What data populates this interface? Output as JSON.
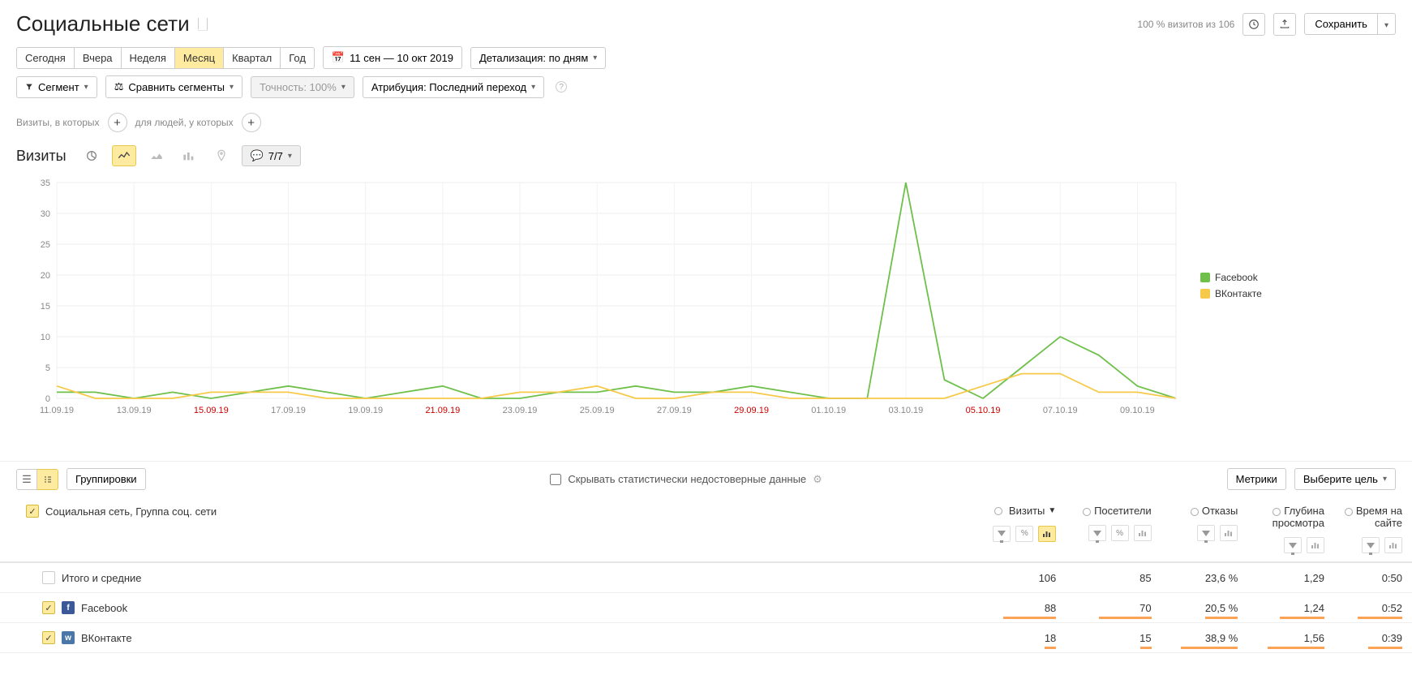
{
  "title": "Социальные сети",
  "visits_info": "100 % визитов из 106",
  "save_label": "Сохранить",
  "periods": {
    "today": "Сегодня",
    "yesterday": "Вчера",
    "week": "Неделя",
    "month": "Месяц",
    "quarter": "Квартал",
    "year": "Год"
  },
  "date_range": "11 сен — 10 окт 2019",
  "detail_label": "Детализация: по дням",
  "segment_label": "Сегмент",
  "compare_label": "Сравнить сегменты",
  "accuracy_label": "Точность: 100%",
  "attribution_label": "Атрибуция: Последний переход",
  "filters": {
    "visits": "Визиты, в которых",
    "people": "для людей, у которых"
  },
  "metric_title": "Визиты",
  "series_count": "7/7",
  "legend": {
    "facebook": "Facebook",
    "vkontakte": "ВКонтакте"
  },
  "colors": {
    "facebook": "#6ec04a",
    "vkontakte": "#f7c948"
  },
  "groupings_label": "Группировки",
  "hide_unreliable": "Скрывать статистически недостоверные данные",
  "metrics_btn": "Метрики",
  "choose_goal": "Выберите цель",
  "dimension_header": "Социальная сеть, Группа соц. сети",
  "columns": {
    "visits": "Визиты",
    "visitors": "Посетители",
    "bounces": "Отказы",
    "depth": "Глубина просмотра",
    "time": "Время на сайте"
  },
  "rows": {
    "total": {
      "name": "Итого и средние",
      "visits": "106",
      "visitors": "85",
      "bounces": "23,6 %",
      "depth": "1,29",
      "time": "0:50"
    },
    "facebook": {
      "name": "Facebook",
      "visits": "88",
      "visitors": "70",
      "bounces": "20,5 %",
      "depth": "1,24",
      "time": "0:52"
    },
    "vkontakte": {
      "name": "ВКонтакте",
      "visits": "18",
      "visitors": "15",
      "bounces": "38,9 %",
      "depth": "1,56",
      "time": "0:39"
    }
  },
  "chart_data": {
    "type": "line",
    "xlabel": "",
    "ylabel": "",
    "ylim": [
      0,
      35
    ],
    "x": [
      "11.09.19",
      "12.09.19",
      "13.09.19",
      "14.09.19",
      "15.09.19",
      "16.09.19",
      "17.09.19",
      "18.09.19",
      "19.09.19",
      "20.09.19",
      "21.09.19",
      "22.09.19",
      "23.09.19",
      "24.09.19",
      "25.09.19",
      "26.09.19",
      "27.09.19",
      "28.09.19",
      "29.09.19",
      "30.09.19",
      "01.10.19",
      "02.10.19",
      "03.10.19",
      "04.10.19",
      "05.10.19",
      "06.10.19",
      "07.10.19",
      "08.10.19",
      "09.10.19",
      "10.10.19"
    ],
    "x_ticks": [
      "11.09.19",
      "13.09.19",
      "15.09.19",
      "17.09.19",
      "19.09.19",
      "21.09.19",
      "23.09.19",
      "25.09.19",
      "27.09.19",
      "29.09.19",
      "01.10.19",
      "03.10.19",
      "05.10.19",
      "07.10.19",
      "09.10.19"
    ],
    "x_red": [
      "15.09.19",
      "21.09.19",
      "29.09.19",
      "05.10.19"
    ],
    "y_ticks": [
      0,
      5,
      10,
      15,
      20,
      25,
      30,
      35
    ],
    "series": [
      {
        "name": "Facebook",
        "color": "#6ec04a",
        "values": [
          1,
          1,
          0,
          1,
          0,
          1,
          2,
          1,
          0,
          1,
          2,
          0,
          0,
          1,
          1,
          2,
          1,
          1,
          2,
          1,
          0,
          0,
          35,
          3,
          0,
          5,
          10,
          7,
          2,
          0
        ]
      },
      {
        "name": "ВКонтакте",
        "color": "#f7c948",
        "values": [
          2,
          0,
          0,
          0,
          1,
          1,
          1,
          0,
          0,
          0,
          0,
          0,
          1,
          1,
          2,
          0,
          0,
          1,
          1,
          0,
          0,
          0,
          0,
          0,
          2,
          4,
          4,
          1,
          1,
          0
        ]
      }
    ]
  }
}
